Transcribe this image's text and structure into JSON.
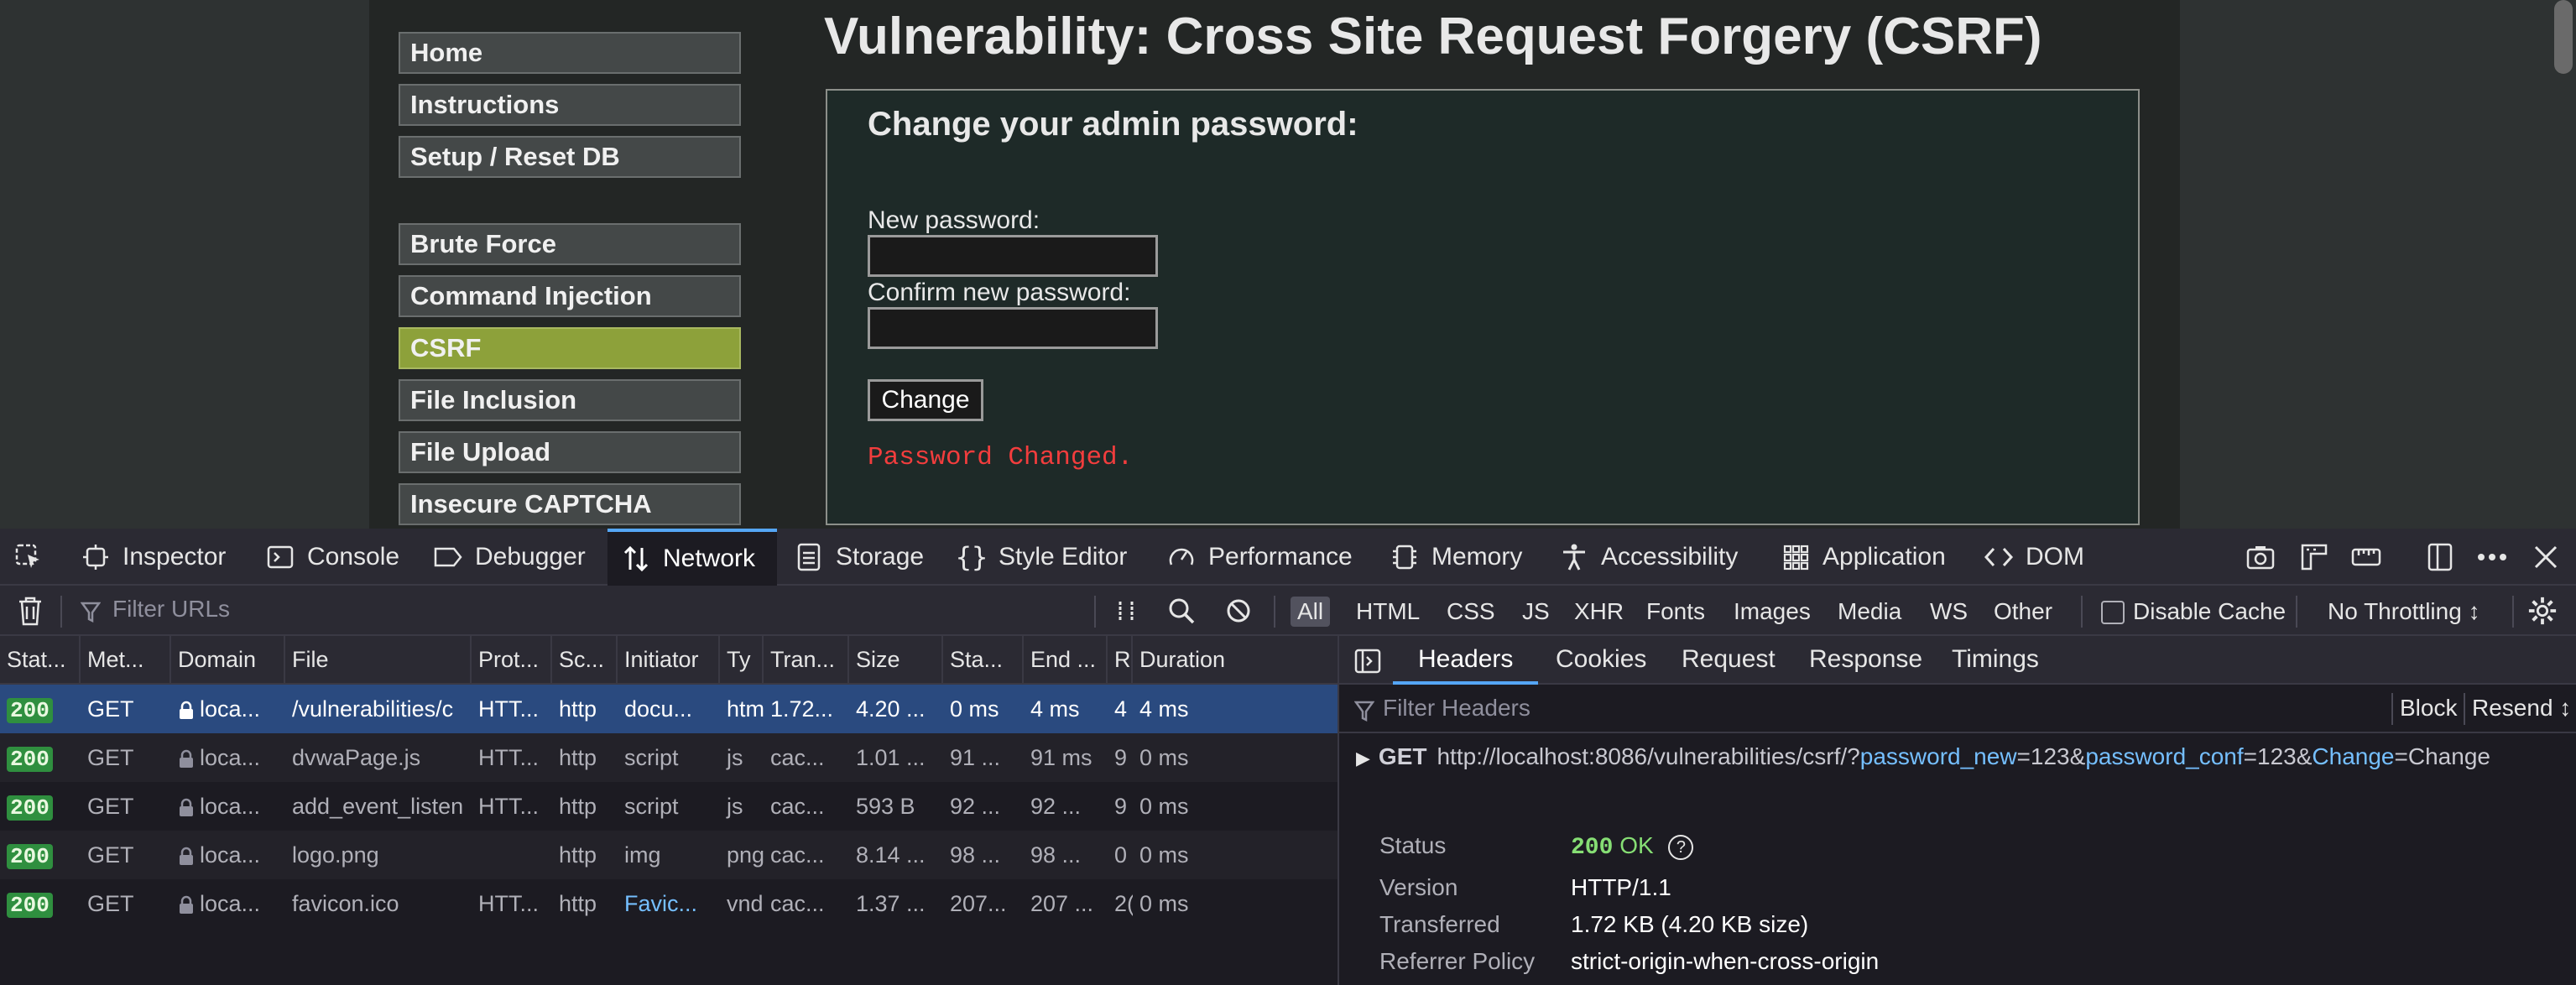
{
  "page": {
    "title": "Vulnerability: Cross Site Request Forgery (CSRF)",
    "menu": [
      {
        "label": "Home",
        "active": false
      },
      {
        "label": "Instructions",
        "active": false
      },
      {
        "label": "Setup / Reset DB",
        "active": false
      },
      {
        "label": "Brute Force",
        "active": false
      },
      {
        "label": "Command Injection",
        "active": false
      },
      {
        "label": "CSRF",
        "active": true
      },
      {
        "label": "File Inclusion",
        "active": false
      },
      {
        "label": "File Upload",
        "active": false
      },
      {
        "label": "Insecure CAPTCHA",
        "active": false
      }
    ],
    "form": {
      "heading": "Change your admin password:",
      "new_password_label": "New password:",
      "new_password_value": "",
      "confirm_password_label": "Confirm new password:",
      "confirm_password_value": "",
      "submit_label": "Change",
      "result_message": "Password Changed."
    }
  },
  "devtools": {
    "tabs": [
      {
        "label": "Inspector",
        "icon": "inspector-icon"
      },
      {
        "label": "Console",
        "icon": "console-icon"
      },
      {
        "label": "Debugger",
        "icon": "debugger-icon"
      },
      {
        "label": "Network",
        "icon": "network-icon",
        "active": true
      },
      {
        "label": "Storage",
        "icon": "storage-icon"
      },
      {
        "label": "Style Editor",
        "icon": "style-editor-icon"
      },
      {
        "label": "Performance",
        "icon": "performance-icon"
      },
      {
        "label": "Memory",
        "icon": "memory-icon"
      },
      {
        "label": "Accessibility",
        "icon": "accessibility-icon"
      },
      {
        "label": "Application",
        "icon": "application-icon"
      },
      {
        "label": "DOM",
        "icon": "dom-icon"
      }
    ],
    "toolbar": {
      "filter_placeholder": "Filter URLs",
      "type_filters": [
        "All",
        "HTML",
        "CSS",
        "JS",
        "XHR",
        "Fonts",
        "Images",
        "Media",
        "WS",
        "Other"
      ],
      "active_filter": "All",
      "disable_cache_label": "Disable Cache",
      "disable_cache_checked": false,
      "throttling_label": "No Throttling ↕"
    },
    "columns": [
      "Stat...",
      "Met...",
      "Domain",
      "File",
      "Prot...",
      "Sc...",
      "Initiator",
      "Ty",
      "Tran...",
      "Size",
      "Sta...",
      "End ...",
      "R",
      "Duration"
    ],
    "requests": [
      {
        "status": "200",
        "method": "GET",
        "domain": "loca...",
        "file": "/vulnerabilities/c",
        "protocol": "HTT...",
        "scheme": "http",
        "initiator": "docu...",
        "type": "htm",
        "transferred": "1.72...",
        "size": "4.20 ...",
        "start": "0 ms",
        "end": "4 ms",
        "r": "4",
        "duration": "4 ms",
        "selected": true
      },
      {
        "status": "200",
        "method": "GET",
        "domain": "loca...",
        "file": "dvwaPage.js",
        "protocol": "HTT...",
        "scheme": "http",
        "initiator": "script",
        "type": "js",
        "transferred": "cac...",
        "size": "1.01 ...",
        "start": "91 ...",
        "end": "91 ms",
        "r": "9",
        "duration": "0 ms"
      },
      {
        "status": "200",
        "method": "GET",
        "domain": "loca...",
        "file": "add_event_listen",
        "protocol": "HTT...",
        "scheme": "http",
        "initiator": "script",
        "type": "js",
        "transferred": "cac...",
        "size": "593 B",
        "start": "92 ...",
        "end": "92 ...",
        "r": "9",
        "duration": "0 ms"
      },
      {
        "status": "200",
        "method": "GET",
        "domain": "loca...",
        "file": "logo.png",
        "protocol": "",
        "scheme": "http",
        "initiator": "img",
        "type": "png",
        "transferred": "cac...",
        "size": "8.14 ...",
        "start": "98 ...",
        "end": "98 ...",
        "r": "0",
        "duration": "0 ms"
      },
      {
        "status": "200",
        "method": "GET",
        "domain": "loca...",
        "file": "favicon.ico",
        "protocol": "HTT...",
        "scheme": "http",
        "initiator": "Favic...",
        "type": "vnd",
        "transferred": "cac...",
        "size": "1.37 ...",
        "start": "207...",
        "end": "207 ...",
        "r": "2(",
        "duration": "0 ms"
      }
    ],
    "side_panel": {
      "tabs": [
        "Headers",
        "Cookies",
        "Request",
        "Response",
        "Timings"
      ],
      "active_tab": "Headers",
      "filter_placeholder": "Filter Headers",
      "block_label": "Block",
      "resend_label": "Resend ↕",
      "request": {
        "method": "GET",
        "url_base": "http://localhost:8086/vulnerabilities/csrf/?",
        "params": [
          {
            "key": "password_new",
            "value": "123"
          },
          {
            "key": "password_conf",
            "value": "123"
          },
          {
            "key": "Change",
            "value": "Change"
          }
        ]
      },
      "info": {
        "status_label": "Status",
        "status_code": "200",
        "status_text": "OK",
        "version_label": "Version",
        "version_value": "HTTP/1.1",
        "transferred_label": "Transferred",
        "transferred_value": "1.72 KB (4.20 KB size)",
        "referrer_label": "Referrer Policy",
        "referrer_value": "strict-origin-when-cross-origin"
      }
    }
  },
  "colors": {
    "accent": "#55a6f5",
    "active_menu": "#8da13a",
    "error_text": "#f23d3d",
    "status_ok": "#86de74"
  }
}
